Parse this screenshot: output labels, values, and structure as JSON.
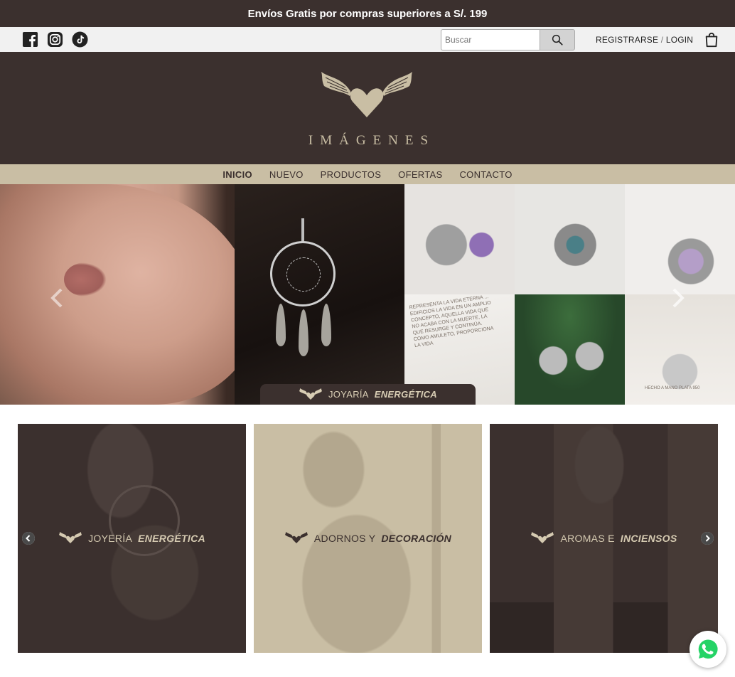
{
  "announcement": {
    "text": "Envíos Gratis por compras superiores a S/. 199"
  },
  "utility": {
    "social": [
      "facebook-icon",
      "instagram-icon",
      "tiktok-icon"
    ],
    "search_placeholder": "Buscar",
    "login_register": "REGISTRARSE",
    "login_sep": " / ",
    "login_login": "LOGIN"
  },
  "header": {
    "brand": "IMÁGENES"
  },
  "nav": {
    "items": [
      {
        "label": "INICIO",
        "active": true
      },
      {
        "label": "NUEVO",
        "active": false
      },
      {
        "label": "PRODUCTOS",
        "active": false
      },
      {
        "label": "OFERTAS",
        "active": false
      },
      {
        "label": "CONTACTO",
        "active": false
      }
    ]
  },
  "hero": {
    "caption_prefix": "JOYARÍA",
    "caption_bold": "ENERGÉTICA",
    "card_text_1": "REPRESENTA LA VIDA ETERNA ... EDIFICIOS LA VIDA EN UN AMPLIO CONCEPTO, AQUELLA VIDA QUE NO ACABA CON LA MUERTE, LA QUE RESURGE Y CONTINÚA. COMO AMULETO, PROPORCIONA LA VIDA",
    "card_text_2": "HECHO A MANO PLATA 950"
  },
  "categories": [
    {
      "prefix": "JOYERÍA",
      "bold": "ENERGÉTICA",
      "theme": "dark"
    },
    {
      "prefix": "ADORNOS Y",
      "bold": "DECORACIÓN",
      "theme": "light"
    },
    {
      "prefix": "AROMAS E",
      "bold": "INCIENSOS",
      "theme": "dark"
    }
  ],
  "colors": {
    "brand_dark": "#3b302e",
    "brand_beige": "#c9bea4",
    "whatsapp": "#25d366"
  }
}
